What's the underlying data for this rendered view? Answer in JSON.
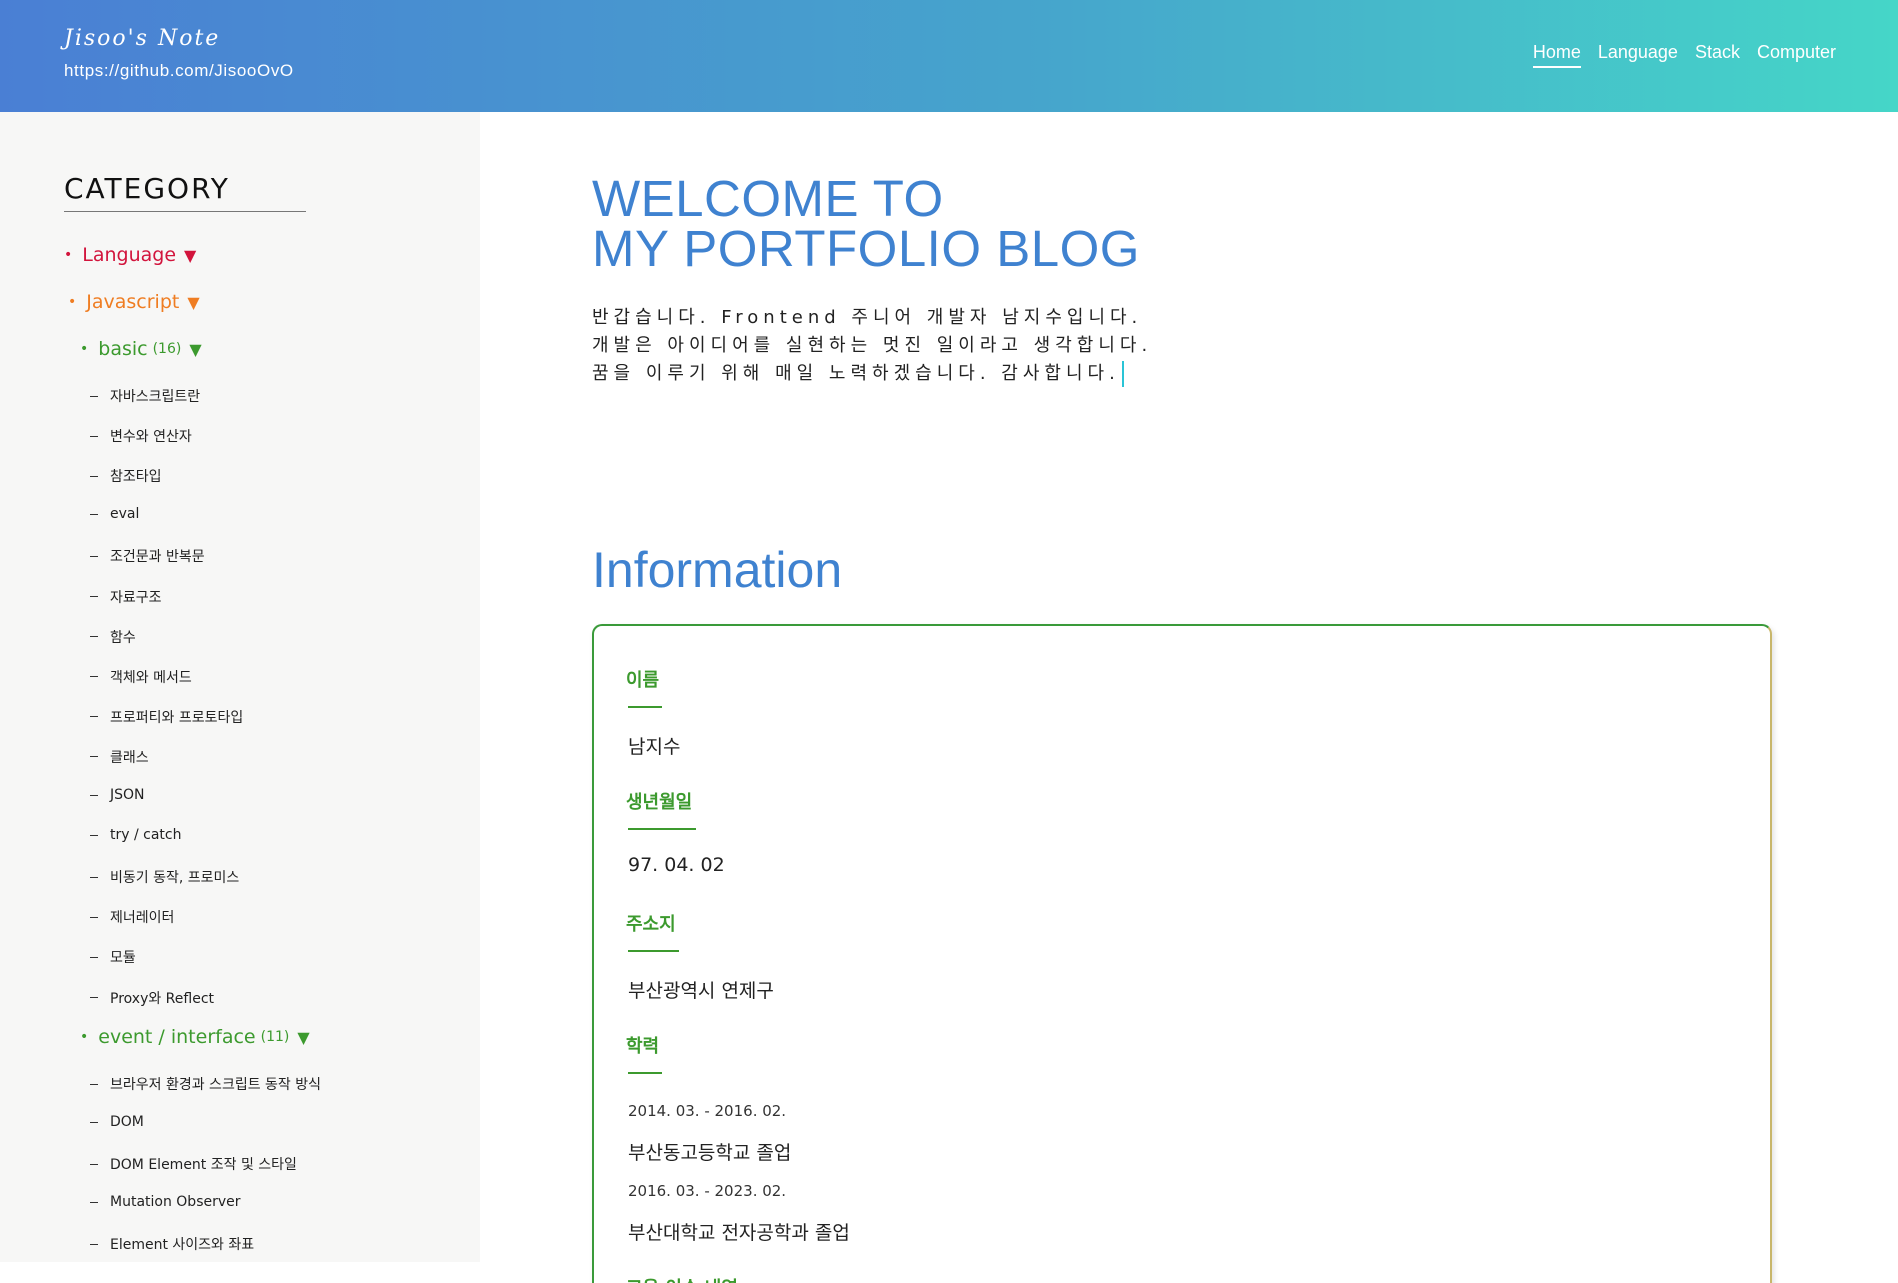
{
  "header": {
    "brand_title": "Jisoo's Note",
    "brand_link": "https://github.com/JisooOvO",
    "nav": [
      "Home",
      "Language",
      "Stack",
      "Computer"
    ],
    "active_nav": "Home"
  },
  "sidebar": {
    "title": "CATEGORY",
    "language": {
      "label": "Language"
    },
    "javascript": {
      "label": "Javascript"
    },
    "basic": {
      "label": "basic",
      "count": "(16)",
      "items": [
        "자바스크립트란",
        "변수와 연산자",
        "참조타입",
        "eval",
        "조건문과 반복문",
        "자료구조",
        "함수",
        "객체와 메서드",
        "프로퍼티와 프로토타입",
        "클래스",
        "JSON",
        "try / catch",
        "비동기 동작, 프로미스",
        "제너레이터",
        "모듈",
        "Proxy와 Reflect"
      ]
    },
    "event": {
      "label": "event / interface",
      "count": "(11)",
      "items": [
        "브라우저 환경과 스크립트 동작 방식",
        "DOM",
        "DOM Element 조작 및 스타일",
        "Mutation Observer",
        "Element 사이즈와 좌표"
      ]
    }
  },
  "main": {
    "welcome_line1": "WELCOME TO",
    "welcome_line2": "MY PORTFOLIO BLOG",
    "intro": [
      "반갑습니다. Frontend 주니어 개발자 남지수입니다.",
      "개발은 아이디어를 실현하는 멋진 일이라고 생각합니다.",
      "꿈을 이루기 위해 매일 노력하겠습니다. 감사합니다."
    ],
    "info_heading": "Information",
    "info": {
      "name_label": "이름",
      "name_value": "남지수",
      "birth_label": "생년월일",
      "birth_value": "97. 04. 02",
      "address_label": "주소지",
      "address_value": "부산광역시 연제구",
      "education_label": "학력",
      "education": [
        {
          "period": "2014. 03. - 2016. 02.",
          "text": "부산동고등학교 졸업"
        },
        {
          "period": "2016. 03. - 2023. 02.",
          "text": "부산대학교 전자공학과 졸업"
        }
      ],
      "next_label": "교육 이수 내역"
    }
  }
}
